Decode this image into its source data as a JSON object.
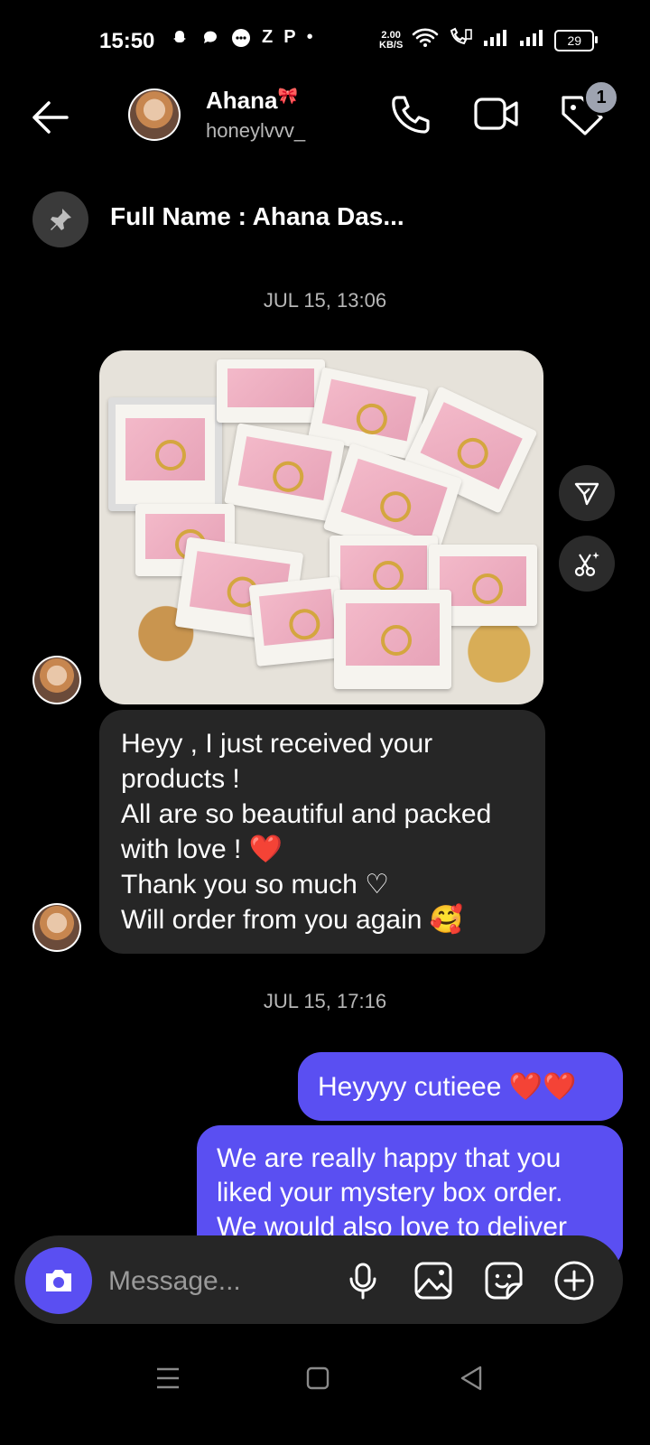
{
  "status_bar": {
    "time": "15:50",
    "letter_z": "Z",
    "letter_p": "P",
    "dot": "•",
    "speed_value": "2.00",
    "speed_unit": "KB/S",
    "battery": "29"
  },
  "header": {
    "name": "Ahana",
    "name_symbol": "🎀",
    "handle": "honeylvvv_",
    "badge_count": "1"
  },
  "pinned": {
    "text": "Full Name : Ahana Das..."
  },
  "timestamps": [
    "JUL 15, 13:06",
    "JUL 15, 17:16"
  ],
  "incoming": {
    "lines": [
      "Heyy , I just received your",
      "products !",
      "All are so beautiful and packed",
      "with love ! ❤️",
      "Thank you so much ♡",
      "Will order from you again 🥰"
    ]
  },
  "outgoing": [
    {
      "lines": [
        "Heyyyy cutieee ❤️❤️"
      ]
    },
    {
      "lines": [
        "We are really happy that you",
        "liked your mystery box order.",
        "We would also love to deliver"
      ]
    }
  ],
  "composer": {
    "placeholder": "Message..."
  },
  "colors": {
    "accent": "#5a4ff2",
    "incoming_bubble": "#262626"
  }
}
